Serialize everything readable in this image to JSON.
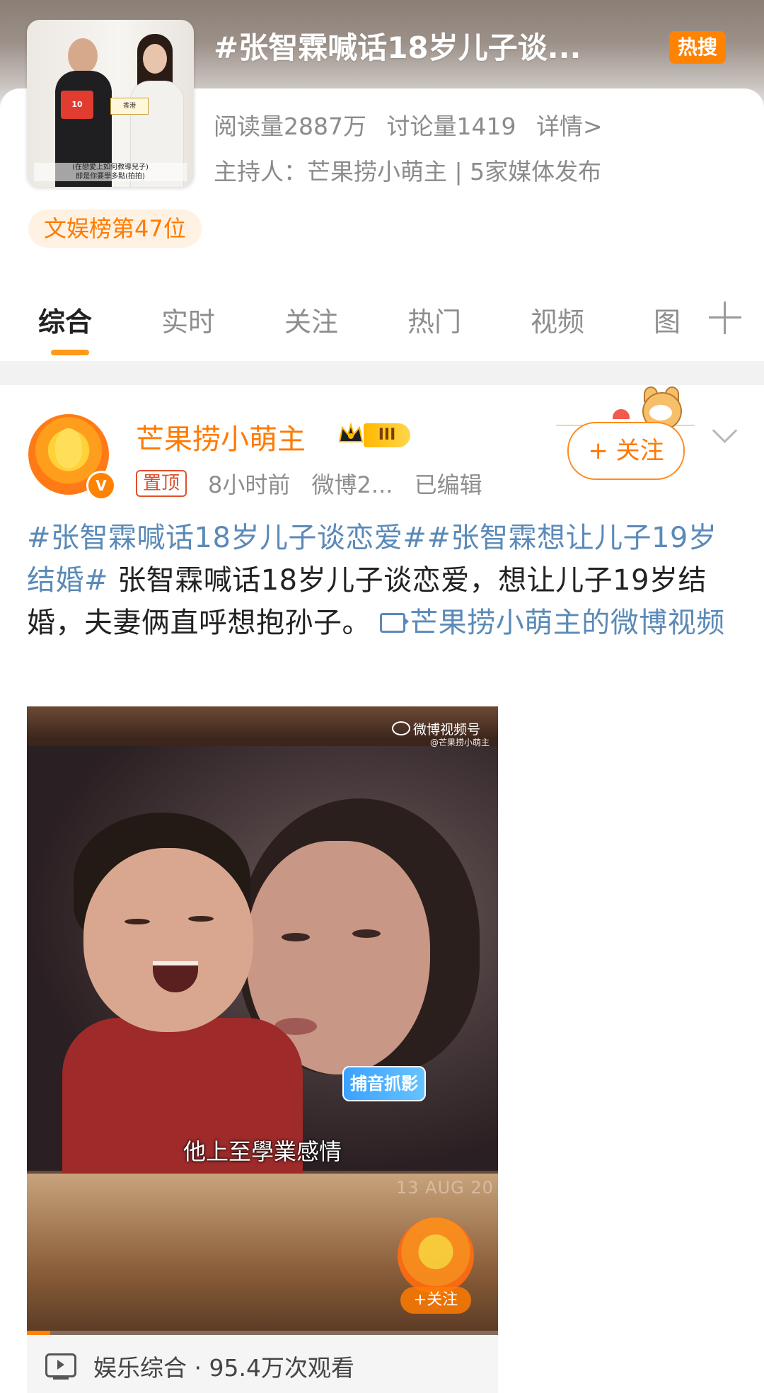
{
  "topic": {
    "title": "#张智霖喊话18岁儿子谈...",
    "hot_badge": "热搜",
    "reads": "阅读量2887万",
    "discussions": "讨论量1419",
    "details_link": "详情>",
    "host": "主持人：芒果捞小萌主 | 5家媒体发布",
    "rank": "文娱榜第47位",
    "cover_caption": "(在戀愛上如何教導兒子)\n即是你要學多點(拍拍)"
  },
  "tabs": [
    {
      "label": "综合",
      "active": true
    },
    {
      "label": "实时"
    },
    {
      "label": "关注"
    },
    {
      "label": "热门"
    },
    {
      "label": "视频"
    },
    {
      "label": "图"
    }
  ],
  "post": {
    "username": "芒果捞小萌主",
    "level": "III",
    "verified_mark": "V",
    "pinned": "置顶",
    "time": "8小时前",
    "source": "微博2...",
    "edited": "已编辑",
    "follow_label": "+ 关注",
    "tag1": "#张智霖喊话18岁儿子谈恋爱#",
    "tag2": "#张智霖想让儿子19岁结婚#",
    "body": " 张智霖喊话18岁儿子谈恋爱，想让儿子19岁结婚，夫妻俩直呼想抱孙子。 ",
    "video_link": "芒果捞小萌主的微博视频"
  },
  "video": {
    "watermark": "微博视频号",
    "watermark_sub": "@芒果捞小萌主",
    "sticker": "捕音抓影",
    "subtitle": "他上至學業感情",
    "frame_date": "13 AUG 20",
    "follow_label": "+关注",
    "progress": 0.05,
    "category": "娱乐综合",
    "views": "· 95.4万次观看"
  },
  "colors": {
    "accent": "#ff8200",
    "link": "#5b8ab8",
    "username": "#ff7a00"
  }
}
